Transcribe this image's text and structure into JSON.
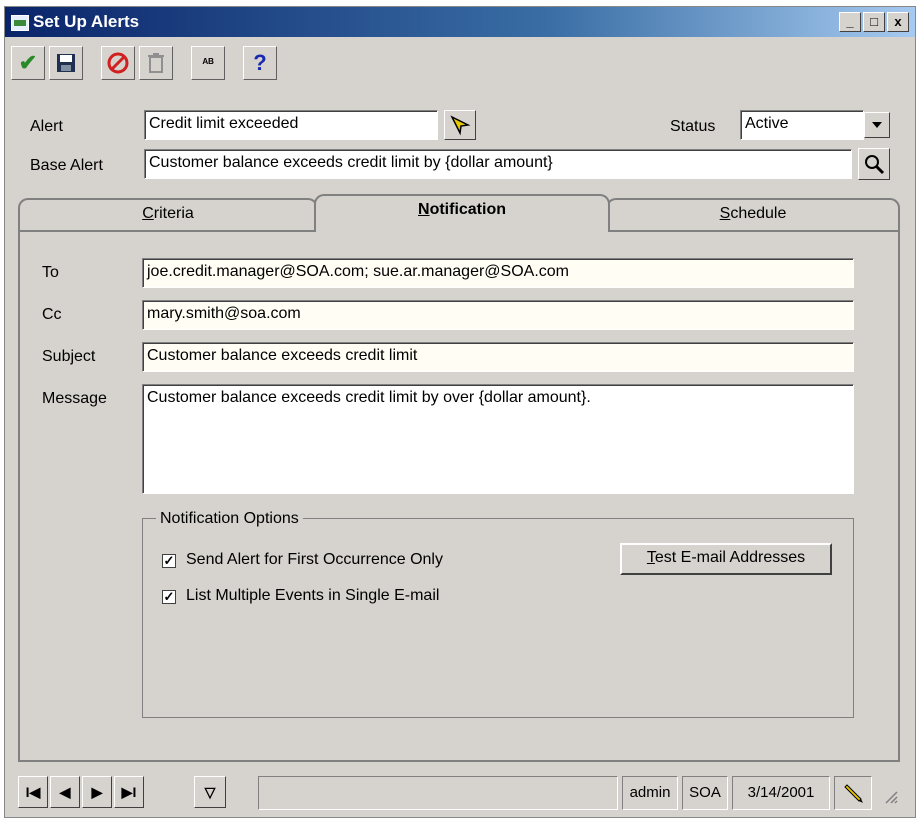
{
  "window": {
    "title": "Set Up Alerts",
    "controls": [
      "_",
      "□",
      "x"
    ]
  },
  "toolbar": {
    "accept": "✔",
    "save": "🖫",
    "cancel": "⊘",
    "delete": "🗑",
    "spell": "ᴬᴮ",
    "help": "?"
  },
  "form": {
    "alert_label": "Alert",
    "alert_value": "Credit limit exceeded",
    "status_label": "Status",
    "status_value": "Active",
    "base_alert_label": "Base Alert",
    "base_alert_value": "Customer balance exceeds credit limit by {dollar amount}"
  },
  "tabs": [
    {
      "label": "Criteria",
      "underline": "C",
      "rest": "riteria"
    },
    {
      "label": "Notification",
      "underline": "N",
      "rest": "otification"
    },
    {
      "label": "Schedule",
      "underline": "S",
      "rest": "chedule"
    }
  ],
  "notification": {
    "to_label": "To",
    "to_value": "joe.credit.manager@SOA.com; sue.ar.manager@SOA.com",
    "cc_label": "Cc",
    "cc_value": "mary.smith@soa.com",
    "subject_label": "Subject",
    "subject_value": "Customer balance exceeds credit limit",
    "message_label": "Message",
    "message_value": "Customer balance exceeds credit limit by over {dollar amount}.",
    "options_title": "Notification Options",
    "option1_label": "Send Alert for First Occurrence Only",
    "option1_checked": true,
    "option2_label": "List Multiple Events in Single E-mail",
    "option2_checked": true,
    "test_button_underline": "T",
    "test_button_rest": "est E-mail Addresses"
  },
  "status": {
    "user": "admin",
    "company": "SOA",
    "date": "3/14/2001"
  },
  "nav": {
    "first": "I◀",
    "prev": "◀",
    "next": "▶",
    "last": "▶I",
    "filter": "▽"
  },
  "colors": {
    "titlebar": "#0a246a",
    "window_bg": "#d6d3ce"
  }
}
